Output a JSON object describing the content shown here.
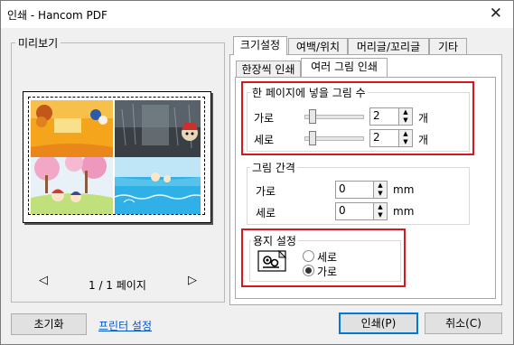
{
  "window": {
    "title": "인쇄 - Hancom PDF"
  },
  "preview": {
    "legend": "미리보기",
    "page_indicator": "1 / 1 페이지"
  },
  "tabs": [
    {
      "label": "크기설정",
      "active": true
    },
    {
      "label": "여백/위치",
      "active": false
    },
    {
      "label": "머리글/꼬리글",
      "active": false
    },
    {
      "label": "기타",
      "active": false
    }
  ],
  "subtabs": [
    {
      "label": "한장씩 인쇄",
      "active": false
    },
    {
      "label": "여러 그림 인쇄",
      "active": true
    }
  ],
  "images_per_page": {
    "title": "한 페이지에 넣을 그림 수",
    "horizontal_label": "가로",
    "horizontal_value": "2",
    "vertical_label": "세로",
    "vertical_value": "2",
    "unit": "개"
  },
  "image_spacing": {
    "title": "그림 간격",
    "horizontal_label": "가로",
    "horizontal_value": "0",
    "vertical_label": "세로",
    "vertical_value": "0",
    "unit": "mm"
  },
  "paper": {
    "title": "용지 설정",
    "options": [
      "세로",
      "가로"
    ],
    "selected": "가로"
  },
  "buttons": {
    "reset": "초기화",
    "printer_settings": "프린터 설정",
    "print": "인쇄(P)",
    "cancel": "취소(C)"
  },
  "colors": {
    "highlight": "#d6191f",
    "link": "#0055cc"
  }
}
